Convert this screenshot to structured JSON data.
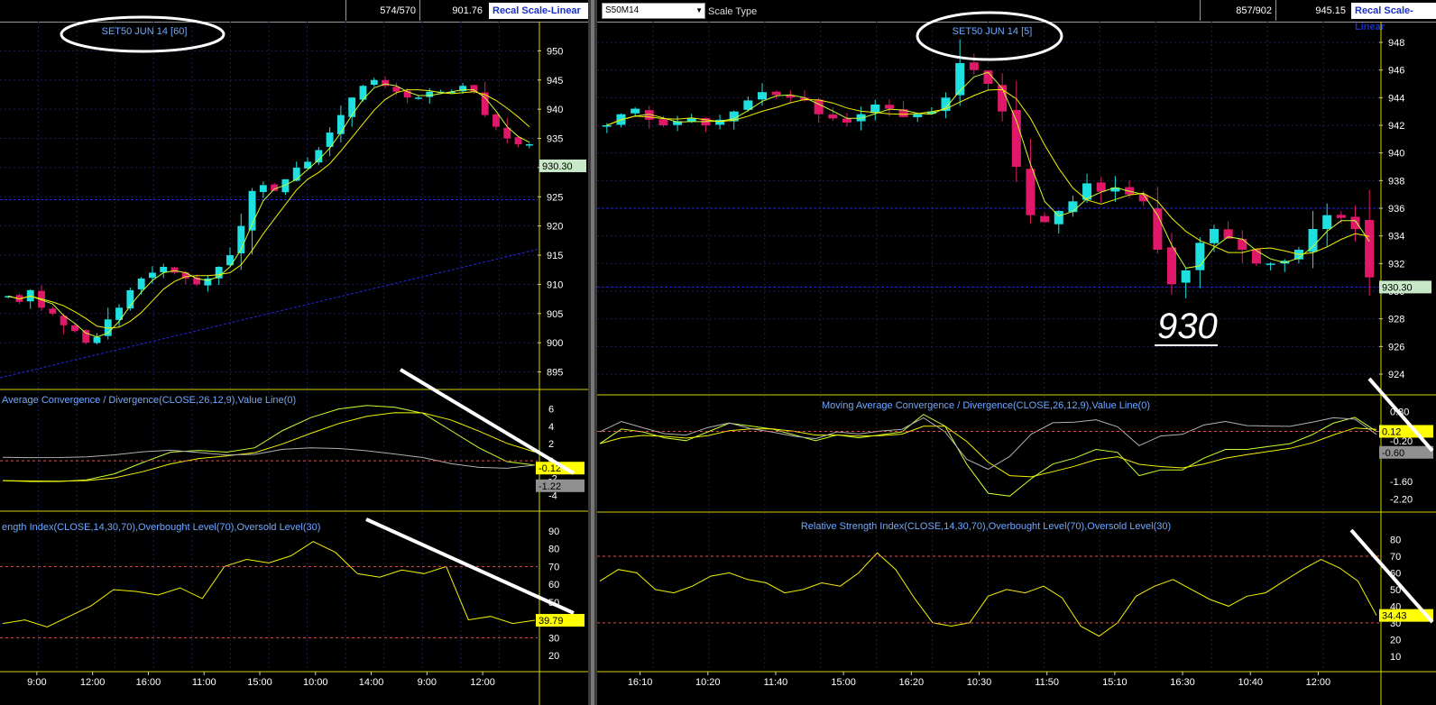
{
  "colors": {
    "background": "#000000",
    "grid": "#1d1d5a",
    "border": "#d4d400",
    "candle_up": "#1fe0e0",
    "candle_down": "#e0186a",
    "ma_fast": "#c8ff30",
    "ma_slow": "#f2f200",
    "ma_mid": "#ffff70",
    "indicator_label": "#6fa8ff",
    "annotation": "#ffffff",
    "signal_gray": "#b0b0b0",
    "trendline": "#2424e0",
    "level_line": "#d05858",
    "yellow_tag": "#ffff00"
  },
  "left": {
    "toolbar": {
      "cell_a": "574/570",
      "cell_b": "901.76",
      "button": "Recal Scale-Linear"
    },
    "title": "SET50 JUN 14  [60]",
    "price_axis": [
      "950",
      "945",
      "940",
      "935",
      "930",
      "925",
      "920",
      "915",
      "910",
      "905",
      "900",
      "895"
    ],
    "last_price": "930.30",
    "macd": {
      "label": "Average Convergence / Divergence(CLOSE,26,12,9),Value Line(0)",
      "axis": [
        "6",
        "4",
        "2",
        "0",
        "-2",
        "-4"
      ],
      "tag_yellow": "-0.12",
      "tag_gray": "-1.22"
    },
    "rsi": {
      "label": "ength Index(CLOSE,14,30,70),Overbought Level(70),Oversold Level(30)",
      "axis": [
        "90",
        "80",
        "70",
        "60",
        "50",
        "40",
        "30",
        "20"
      ],
      "tag": "39.79"
    },
    "time_axis": [
      "9:00",
      "12:00",
      "16:00",
      "11:00",
      "15:00",
      "10:00",
      "14:00",
      "9:00",
      "12:00"
    ]
  },
  "right": {
    "toolbar": {
      "symbol": "S50M14",
      "scale_type": "Scale Type",
      "cell_a": "857/902",
      "cell_b": "945.15",
      "button": "Recal Scale-Linear"
    },
    "title": "SET50 JUN 14  [5]",
    "price_axis": [
      "948",
      "946",
      "944",
      "942",
      "940",
      "938",
      "936",
      "934",
      "932",
      "930",
      "928",
      "926",
      "924"
    ],
    "last_price": "930.30",
    "annotation_text": "930",
    "macd": {
      "label": "Moving Average Convergence / Divergence(CLOSE,26,12,9),Value Line(0)",
      "axis": [
        "0.80",
        "-0.20",
        "-1.60",
        "-2.20"
      ],
      "tag_yellow": "0.12",
      "tag_gray": "-0.60"
    },
    "rsi": {
      "label": "Relative Strength Index(CLOSE,14,30,70),Overbought Level(70),Oversold Level(30)",
      "axis": [
        "80",
        "70",
        "60",
        "50",
        "40",
        "30",
        "20",
        "10"
      ],
      "tag": "34.43"
    },
    "time_axis": [
      "16:10",
      "10:20",
      "11:40",
      "15:00",
      "16:20",
      "10:30",
      "11:50",
      "15:10",
      "16:30",
      "10:40",
      "12:00"
    ]
  },
  "chart_data": [
    {
      "type": "candlestick",
      "title": "SET50 JUN 14  [60]",
      "ylim": [
        892,
        955
      ],
      "last": 930.3,
      "series": [
        {
          "name": "close",
          "values": [
            908,
            907,
            909,
            906,
            905,
            903,
            902,
            900,
            901,
            904,
            906,
            909,
            911,
            912,
            913,
            912,
            911,
            910,
            911,
            913,
            915,
            920,
            926,
            927,
            926,
            928,
            930,
            931,
            933,
            936,
            939,
            942,
            944,
            945,
            944,
            943,
            942,
            942,
            943,
            943,
            943,
            944,
            943,
            939,
            937,
            935,
            934,
            934
          ]
        }
      ],
      "macd": {
        "ylim": [
          -5,
          7
        ],
        "values": [
          -2.3,
          -2.4,
          -2.4,
          -2.2,
          -1.5,
          -0.2,
          1.0,
          1.2,
          1.0,
          1.5,
          3.5,
          5.0,
          6.0,
          6.4,
          6.2,
          5.5,
          3.5,
          1.5,
          -0.1,
          -0.5
        ]
      },
      "rsi": {
        "ylim": [
          15,
          95
        ],
        "levels": [
          70,
          30
        ],
        "values": [
          38,
          40,
          36,
          42,
          48,
          57,
          56,
          54,
          58,
          52,
          70,
          74,
          72,
          76,
          84,
          78,
          66,
          64,
          68,
          66,
          70,
          40,
          42,
          38,
          39.79
        ]
      }
    },
    {
      "type": "candlestick",
      "title": "SET50 JUN 14  [5]",
      "ylim": [
        922.5,
        949.5
      ],
      "last": 930.3,
      "series": [
        {
          "name": "close",
          "values": [
            942,
            942.8,
            943.2,
            942.4,
            942,
            942.3,
            942.5,
            942,
            942.4,
            943,
            943.8,
            944.4,
            944.2,
            944,
            943.8,
            942.8,
            942.5,
            942.2,
            942.8,
            943.5,
            943.2,
            942.6,
            942.8,
            943,
            944,
            946.5,
            946,
            945,
            943,
            939,
            935.5,
            935,
            935.8,
            936.5,
            937.8,
            937.2,
            937.5,
            937,
            936.5,
            933,
            930.5,
            931.5,
            933.5,
            934.5,
            933.8,
            933,
            932,
            932,
            932.2,
            933,
            934.5,
            935.5,
            935.3,
            934.5,
            931
          ]
        }
      ],
      "macd": {
        "ylim": [
          -2.4,
          1.0
        ],
        "values": [
          -0.3,
          0.2,
          0.1,
          -0.1,
          -0.2,
          0.1,
          0.4,
          0.3,
          0.2,
          0.0,
          -0.2,
          0.0,
          -0.1,
          0.0,
          0.1,
          0.7,
          0.3,
          -1.0,
          -2.0,
          -2.1,
          -1.5,
          -1.0,
          -0.8,
          -0.5,
          -0.6,
          -1.4,
          -1.2,
          -1.2,
          -0.8,
          -0.5,
          -0.5,
          -0.4,
          -0.3,
          0.0,
          0.4,
          0.6,
          0.12
        ]
      },
      "rsi": {
        "ylim": [
          5,
          90
        ],
        "levels": [
          70,
          30
        ],
        "values": [
          55,
          62,
          60,
          50,
          48,
          52,
          58,
          60,
          56,
          54,
          48,
          50,
          54,
          52,
          60,
          72,
          62,
          45,
          30,
          28,
          30,
          46,
          50,
          48,
          52,
          45,
          28,
          22,
          30,
          46,
          52,
          56,
          50,
          44,
          40,
          46,
          48,
          55,
          62,
          68,
          63,
          55,
          34.43
        ]
      }
    }
  ]
}
